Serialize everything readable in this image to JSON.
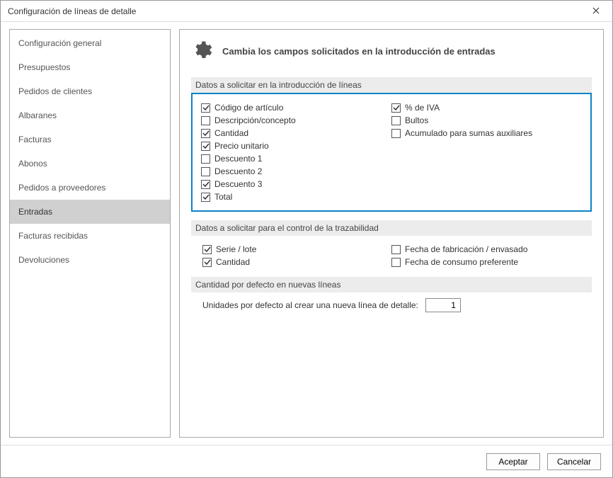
{
  "window": {
    "title": "Configuración de líneas de detalle"
  },
  "sidebar": {
    "items": [
      {
        "label": "Configuración general"
      },
      {
        "label": "Presupuestos"
      },
      {
        "label": "Pedidos de clientes"
      },
      {
        "label": "Albaranes"
      },
      {
        "label": "Facturas"
      },
      {
        "label": "Abonos"
      },
      {
        "label": "Pedidos a proveedores"
      },
      {
        "label": "Entradas"
      },
      {
        "label": "Facturas recibidas"
      },
      {
        "label": "Devoluciones"
      }
    ],
    "selected_index": 7
  },
  "main": {
    "heading": "Cambia los campos solicitados en la introducción de entradas",
    "section1": {
      "title": "Datos a solicitar en la introducción de líneas",
      "left": [
        {
          "label": "Código de artículo",
          "checked": true
        },
        {
          "label": "Descripción/concepto",
          "checked": false
        },
        {
          "label": "Cantidad",
          "checked": true
        },
        {
          "label": "Precio unitario",
          "checked": true
        },
        {
          "label": "Descuento 1",
          "checked": false
        },
        {
          "label": "Descuento 2",
          "checked": false
        },
        {
          "label": "Descuento 3",
          "checked": true
        },
        {
          "label": "Total",
          "checked": true
        }
      ],
      "right": [
        {
          "label": "% de IVA",
          "checked": true
        },
        {
          "label": "Bultos",
          "checked": false
        },
        {
          "label": "Acumulado para sumas auxiliares",
          "checked": false
        }
      ]
    },
    "section2": {
      "title": "Datos a solicitar para el control de la trazabilidad",
      "left": [
        {
          "label": "Serie / lote",
          "checked": true
        },
        {
          "label": "Cantidad",
          "checked": true
        }
      ],
      "right": [
        {
          "label": "Fecha de fabricación / envasado",
          "checked": false
        },
        {
          "label": "Fecha de consumo preferente",
          "checked": false
        }
      ]
    },
    "section3": {
      "title": "Cantidad por defecto en nuevas líneas",
      "field_label": "Unidades por defecto al crear una nueva línea de detalle:",
      "field_value": "1"
    }
  },
  "footer": {
    "accept": "Aceptar",
    "cancel": "Cancelar"
  }
}
